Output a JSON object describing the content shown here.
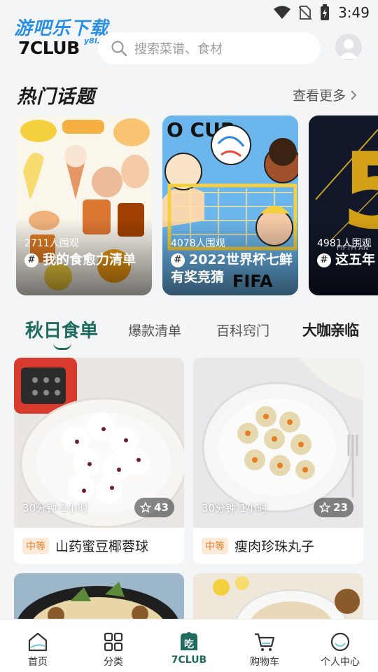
{
  "status_bar": {
    "time": "3:49"
  },
  "header": {
    "watermark": "游吧乐下载",
    "watermark_sub": "y8l.com",
    "brand": "7CLUB",
    "search_placeholder": "搜索菜谱、食材"
  },
  "hot_topics": {
    "title": "热门话题",
    "see_more": "查看更多",
    "cards": [
      {
        "views": "2711人围观",
        "title": "我的食愈力清单"
      },
      {
        "views": "4078人围观",
        "title": "2022世界杯七鲜有奖竞猜"
      },
      {
        "views": "4981人围观",
        "title": "这五年"
      }
    ]
  },
  "tabs": {
    "items": [
      "秋日食单",
      "爆款清单",
      "百科窍门"
    ],
    "special": "大咖亲临",
    "active_index": 0
  },
  "recipes": [
    {
      "time": "30分钟-1小时",
      "stars": "43",
      "difficulty": "中等",
      "name": "山药蜜豆椰蓉球"
    },
    {
      "time": "30分钟-1小时",
      "stars": "23",
      "difficulty": "中等",
      "name": "瘦肉珍珠丸子"
    }
  ],
  "bottom_nav": [
    {
      "label": "首页",
      "icon": "home-icon"
    },
    {
      "label": "分类",
      "icon": "category-grid-icon"
    },
    {
      "label": "7CLUB",
      "icon": "eat-icon"
    },
    {
      "label": "购物车",
      "icon": "cart-icon"
    },
    {
      "label": "个人中心",
      "icon": "profile-icon"
    }
  ],
  "colors": {
    "accent": "#1f6b5d",
    "difficulty_text": "#e67e2a",
    "difficulty_bg": "#fdebd9",
    "watermark": "#2a8fe8"
  }
}
